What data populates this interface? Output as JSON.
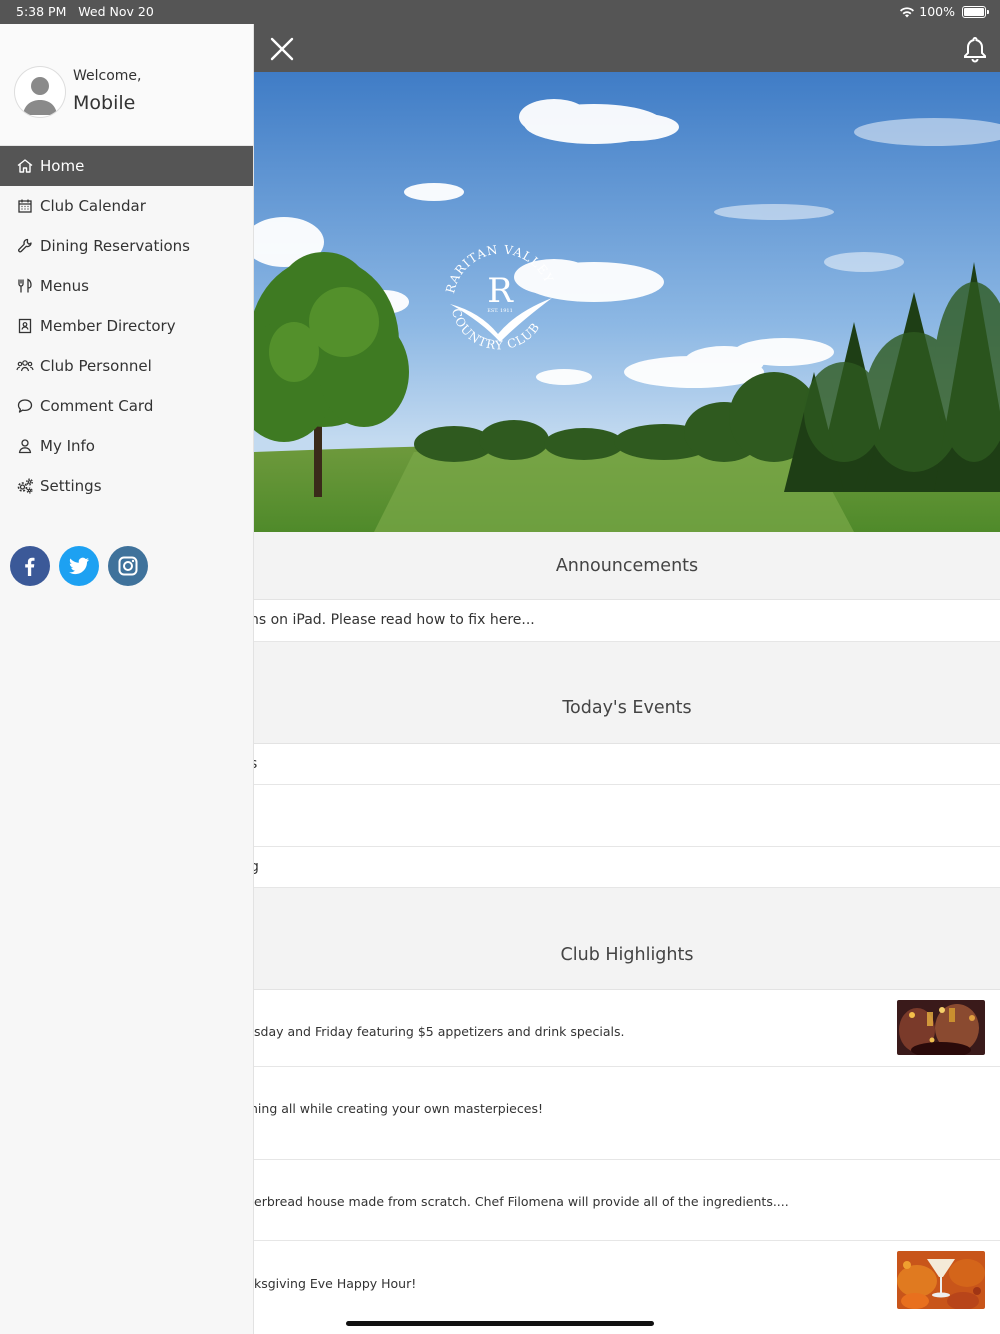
{
  "status_bar": {
    "time": "5:38 PM",
    "date": "Wed Nov 20",
    "battery": "100%"
  },
  "sidebar": {
    "welcome": "Welcome,",
    "user_name": "Mobile",
    "items": [
      {
        "label": "Home",
        "icon": "home-icon"
      },
      {
        "label": "Club Calendar",
        "icon": "calendar-icon"
      },
      {
        "label": "Dining Reservations",
        "icon": "wrench-icon"
      },
      {
        "label": "Menus",
        "icon": "utensils-icon"
      },
      {
        "label": "Member Directory",
        "icon": "address-book-icon"
      },
      {
        "label": "Club Personnel",
        "icon": "users-icon"
      },
      {
        "label": "Comment Card",
        "icon": "comment-icon"
      },
      {
        "label": "My Info",
        "icon": "user-icon"
      },
      {
        "label": "Settings",
        "icon": "cogs-icon"
      }
    ],
    "socials": [
      "facebook-icon",
      "twitter-icon",
      "instagram-icon"
    ]
  },
  "hero": {
    "logo_text_top": "RARITAN VALLEY",
    "logo_text_bottom": "COUNTRY CLUB",
    "logo_letter": "R",
    "logo_est": "EST. 1911"
  },
  "announcements": {
    "title": "Announcements",
    "items": [
      "ns on iPad. Please read how to fix here..."
    ]
  },
  "events": {
    "title": "Today's Events",
    "items": [
      "s",
      "",
      "g"
    ]
  },
  "highlights": {
    "title": "Club Highlights",
    "items": [
      "sday and Friday featuring $5 appetizers and drink specials.",
      "ning all while creating your own masterpieces!",
      "erbread house made from scratch. Chef Filomena will provide all of the ingredients....",
      "ksgiving Eve Happy Hour!"
    ]
  },
  "colors": {
    "header_bg": "#555555",
    "active_nav": "#555555",
    "facebook": "#3b5998",
    "twitter": "#1da1f2",
    "instagram": "#3f729b"
  }
}
